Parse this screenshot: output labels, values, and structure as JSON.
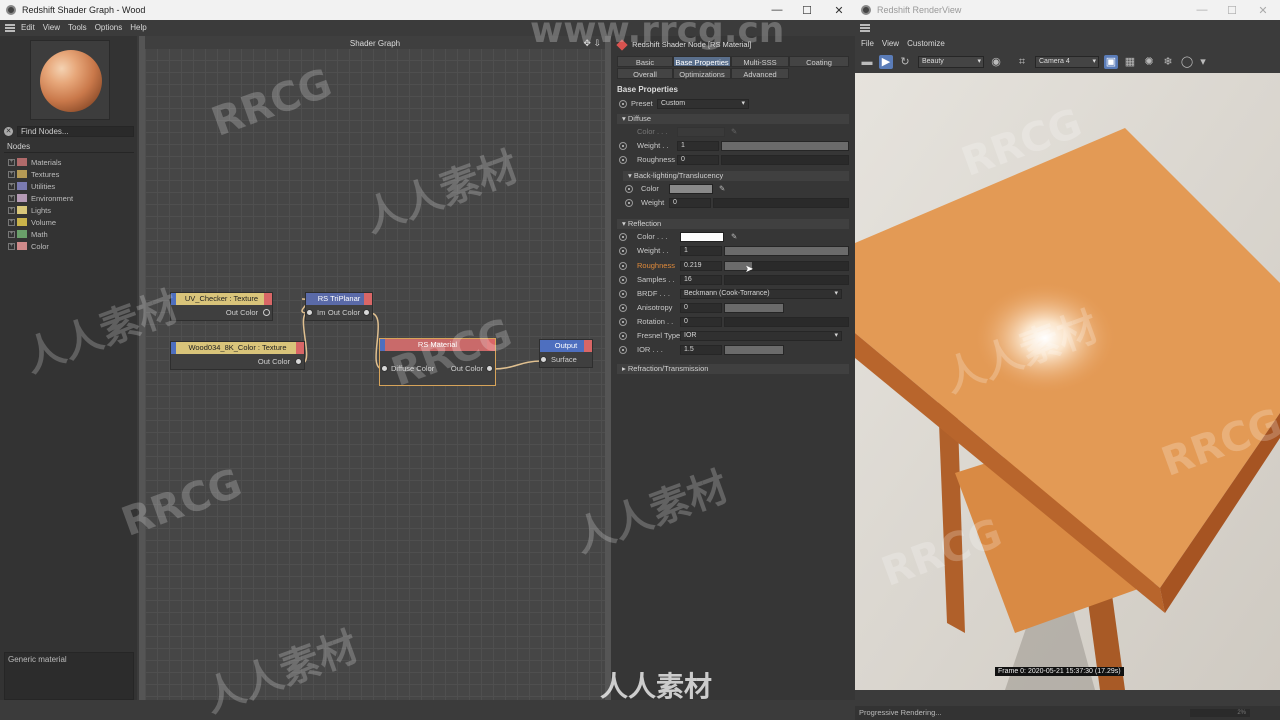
{
  "shader_window": {
    "title": "Redshift Shader Graph - Wood",
    "menu": [
      "Edit",
      "View",
      "Tools",
      "Options",
      "Help"
    ],
    "find_placeholder": "Find Nodes...",
    "nodes_header": "Nodes",
    "tree": [
      {
        "label": "Materials",
        "color": "#b06a6a"
      },
      {
        "label": "Textures",
        "color": "#b59a55"
      },
      {
        "label": "Utilities",
        "color": "#7a7ab0"
      },
      {
        "label": "Environment",
        "color": "#b59ab5"
      },
      {
        "label": "Lights",
        "color": "#d8c67a"
      },
      {
        "label": "Volume",
        "color": "#c9b24a"
      },
      {
        "label": "Math",
        "color": "#6aa06a"
      },
      {
        "label": "Color",
        "color": "#d08a8a"
      }
    ],
    "generic_text": "Generic material",
    "graph_title": "Shader Graph",
    "nodes": {
      "uv_checker": {
        "title": "UV_Checker : Texture",
        "out": "Out Color"
      },
      "wood": {
        "title": "Wood034_8K_Color : Texture",
        "out": "Out Color"
      },
      "triplanar": {
        "title": "RS TriPlanar",
        "in": "Im",
        "out": "Out Color"
      },
      "material": {
        "title": "RS Material",
        "in": "Diffuse Color",
        "out": "Out Color"
      },
      "output": {
        "title": "Output",
        "in": "Surface"
      }
    }
  },
  "attributes": {
    "header": "Redshift Shader Node [RS Material]",
    "tabs_row1": [
      "Basic",
      "Base Properties",
      "Multi-SSS",
      "Coating"
    ],
    "tabs_row2": [
      "Overall",
      "Optimizations",
      "Advanced"
    ],
    "active_tab": "Base Properties",
    "base_properties": "Base Properties",
    "preset_label": "Preset",
    "preset_value": "Custom",
    "diffuse": {
      "section": "Diffuse",
      "color_label": "Color . . .",
      "weight_label": "Weight . .",
      "weight": "1",
      "roughness_label": "Roughness",
      "roughness": "0"
    },
    "backlighting": {
      "section": "Back-lighting/Translucency",
      "color_label": "Color",
      "weight_label": "Weight",
      "weight": "0"
    },
    "reflection": {
      "section": "Reflection",
      "color_label": "Color . . .",
      "weight_label": "Weight . .",
      "weight": "1",
      "weight_level": 1.0,
      "roughness_label": "Roughness",
      "roughness": "0.219",
      "roughness_level": 0.219,
      "samples_label": "Samples . .",
      "samples": "16",
      "brdf_label": "BRDF . . .",
      "brdf": "Beckmann (Cook-Torrance)",
      "aniso_label": "Anisotropy",
      "aniso": "0",
      "rotation_label": "Rotation . .",
      "rotation": "0",
      "fresnel_label": "Fresnel Type",
      "fresnel": "IOR",
      "ior_label": "IOR . . .",
      "ior": "1.5"
    },
    "refraction_section": "Refraction/Transmission",
    "reflection_color": "#ffffff",
    "diffuse_color": "#8a8a8a"
  },
  "render_window": {
    "title": "Redshift RenderView",
    "menu": [
      "File",
      "View",
      "Customize"
    ],
    "aov": "Beauty",
    "camera": "Camera 4",
    "frame_info": "Frame 0:  2020-05-21  15:37:30  (17.29s)",
    "status": "Progressive Rendering...",
    "progress": "2%"
  },
  "watermarks": {
    "site": "www.rrcg.cn",
    "brand": "RRCG",
    "cn": "人人素材"
  }
}
